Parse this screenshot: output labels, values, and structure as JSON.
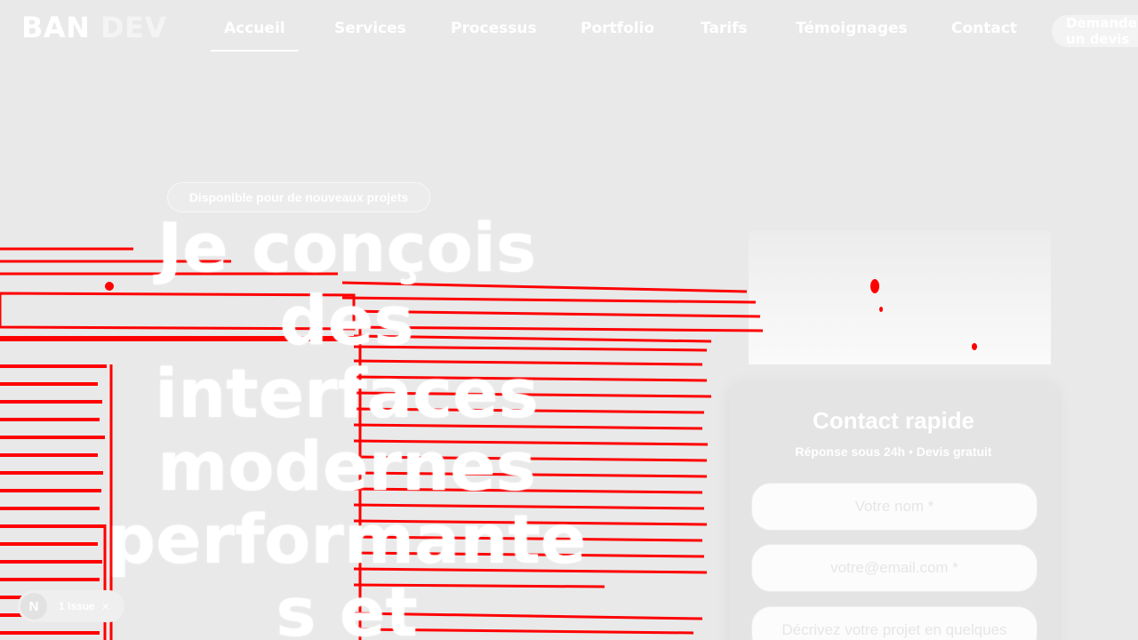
{
  "logo": {
    "strong": "BAN",
    "light": "DEV"
  },
  "nav": {
    "items": [
      {
        "label": "Accueil",
        "active": true
      },
      {
        "label": "Services"
      },
      {
        "label": "Processus"
      },
      {
        "label": "Portfolio"
      },
      {
        "label": "Tarifs"
      },
      {
        "label": "Témoignages"
      },
      {
        "label": "Contact"
      }
    ],
    "cta": {
      "line1": "Demander",
      "line2": "un devis"
    }
  },
  "hero": {
    "badge": "Disponible pour de nouveaux projets",
    "title_lines": [
      "Je conçois",
      "des",
      "interfaces",
      "modernes",
      "performante",
      "s et"
    ]
  },
  "contact": {
    "title": "Contact rapide",
    "subtitle": "Réponse sous 24h • Devis gratuit",
    "name_placeholder": "Votre nom *",
    "email_placeholder": "votre@email.com *",
    "message_placeholder": "Décrivez votre projet en quelques"
  },
  "dev_overlay": {
    "logo_letter": "N",
    "issue_label": "1 Issue",
    "close_symbol": "×"
  },
  "colors": {
    "background": "#e9e9e9",
    "text": "#ffffff",
    "artifact": "#ff0000"
  }
}
